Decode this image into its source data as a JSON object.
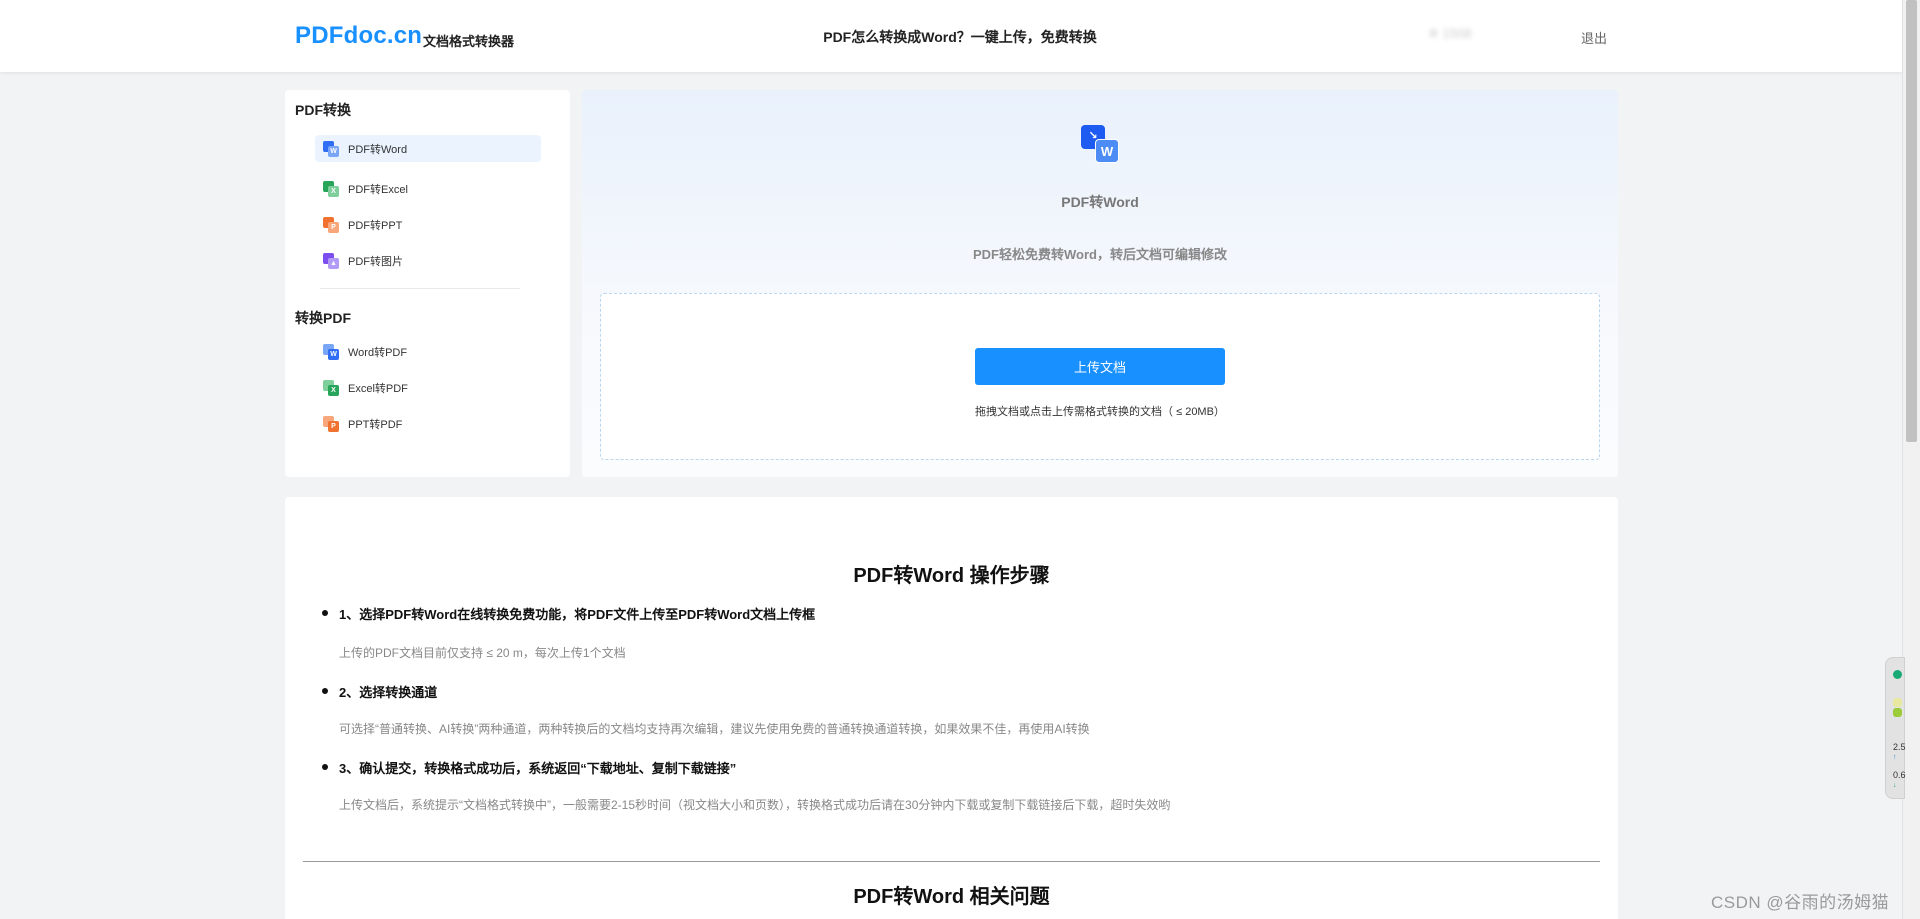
{
  "header": {
    "logo": "PDFdoc.cn",
    "logo_sub": "文档格式转换器",
    "center_text": "PDF怎么转换成Word？一键上传，免费转换",
    "user": "※ 1508 ",
    "logout": "退出"
  },
  "sidebar": {
    "group1_title": "PDF转换",
    "group1_items": [
      {
        "label": "PDF转Word",
        "icon": "word-icon",
        "icon_letter": "W",
        "color": "#2f6ef5",
        "light": "#7aa6f7"
      },
      {
        "label": "PDF转Excel",
        "icon": "excel-icon",
        "icon_letter": "X",
        "color": "#27a55a",
        "light": "#7fcf9c"
      },
      {
        "label": "PDF转PPT",
        "icon": "ppt-icon",
        "icon_letter": "P",
        "color": "#f0722e",
        "light": "#f7a77a"
      },
      {
        "label": "PDF转图片",
        "icon": "image-icon",
        "icon_letter": "▲",
        "color": "#7c4ef0",
        "light": "#b29bf6"
      }
    ],
    "group2_title": "转换PDF",
    "group2_items": [
      {
        "label": "Word转PDF",
        "icon": "word-to-pdf-icon",
        "icon_letter": "W",
        "color": "#2f6ef5",
        "light": "#7aa6f7"
      },
      {
        "label": "Excel转PDF",
        "icon": "excel-to-pdf-icon",
        "icon_letter": "X",
        "color": "#27a55a",
        "light": "#7fcf9c"
      },
      {
        "label": "PPT转PDF",
        "icon": "ppt-to-pdf-icon",
        "icon_letter": "P",
        "color": "#f0722e",
        "light": "#f7a77a"
      }
    ]
  },
  "panel": {
    "icon_letter": "W",
    "title": "PDF转Word",
    "description": "PDF轻松免费转Word，转后文档可编辑修改",
    "upload_button": "上传文档",
    "upload_hint": "拖拽文档或点击上传需格式转换的文档（ ≤ 20MB）"
  },
  "steps": {
    "title": "PDF转Word 操作步骤",
    "items": [
      {
        "heading": "1、选择PDF转Word在线转换免费功能，将PDF文件上传至PDF转Word文档上传框",
        "text": "上传的PDF文档目前仅支持 ≤ 20 m，每次上传1个文档"
      },
      {
        "heading": "2、选择转换通道",
        "text": "可选择“普通转换、AI转换”两种通道，两种转换后的文档均支持再次编辑，建议先使用免费的普通转换通道转换，如果效果不佳，再使用AI转换"
      },
      {
        "heading": "3、确认提交，转换格式成功后，系统返回“下载地址、复制下载链接”",
        "text": "上传文档后，系统提示“文档格式转换中”，一般需要2-15秒时间（视文档大小和页数），转换格式成功后请在30分钟内下载或复制下载链接后下载，超时失效哟"
      }
    ],
    "faq_title": "PDF转Word 相关问题"
  },
  "widget": {
    "num1": "2.5",
    "num2": "0.6"
  },
  "watermark": "CSDN @谷雨的汤姆猫"
}
